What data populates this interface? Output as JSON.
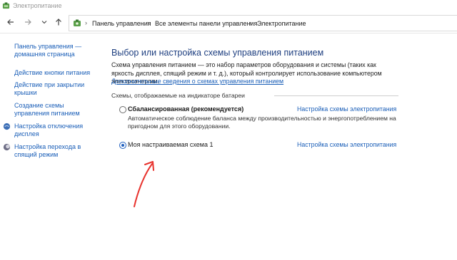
{
  "window": {
    "title": "Электропитание"
  },
  "nav": {
    "back_icon": "arrow-left-icon",
    "forward_icon": "arrow-right-icon",
    "dropdown_icon": "chevron-down-icon",
    "up_icon": "arrow-up-icon"
  },
  "breadcrumb": {
    "items": [
      "Панель управления",
      "Все элементы панели управления",
      "Электропитание"
    ],
    "separator": "›"
  },
  "sidebar": {
    "items": [
      {
        "label": "Панель управления — домашняя страница"
      },
      {
        "label": "Действие кнопки питания"
      },
      {
        "label": "Действие при закрытии крышки"
      },
      {
        "label": "Создание схемы управления питанием"
      },
      {
        "label": "Настройка отключения дисплея"
      },
      {
        "label": "Настройка перехода в спящий режим"
      }
    ]
  },
  "main": {
    "heading": "Выбор или настройка схемы управления питанием",
    "description": "Схема управления питанием — это набор параметров оборудования и системы (таких как яркость дисплея, спящий режим и т. д.), который контролирует использование компьютером электроэнергии.",
    "more_link": "Дополнительные сведения о схемах управления питанием",
    "group_label": "Схемы, отображаемые на индикаторе батареи",
    "plans": [
      {
        "name": "Сбалансированная (рекомендуется)",
        "selected": false,
        "description": "Автоматическое соблюдение баланса между производительностью и энергопотреблением на пригодном для этого оборудовании.",
        "link": "Настройка схемы электропитания"
      },
      {
        "name": "Моя настраиваемая схема 1",
        "selected": true,
        "description": "",
        "link": "Настройка схемы электропитания"
      }
    ]
  },
  "colors": {
    "link": "#1b5fb8",
    "heading": "#1e3f80",
    "annotation_arrow": "#e8322d"
  }
}
